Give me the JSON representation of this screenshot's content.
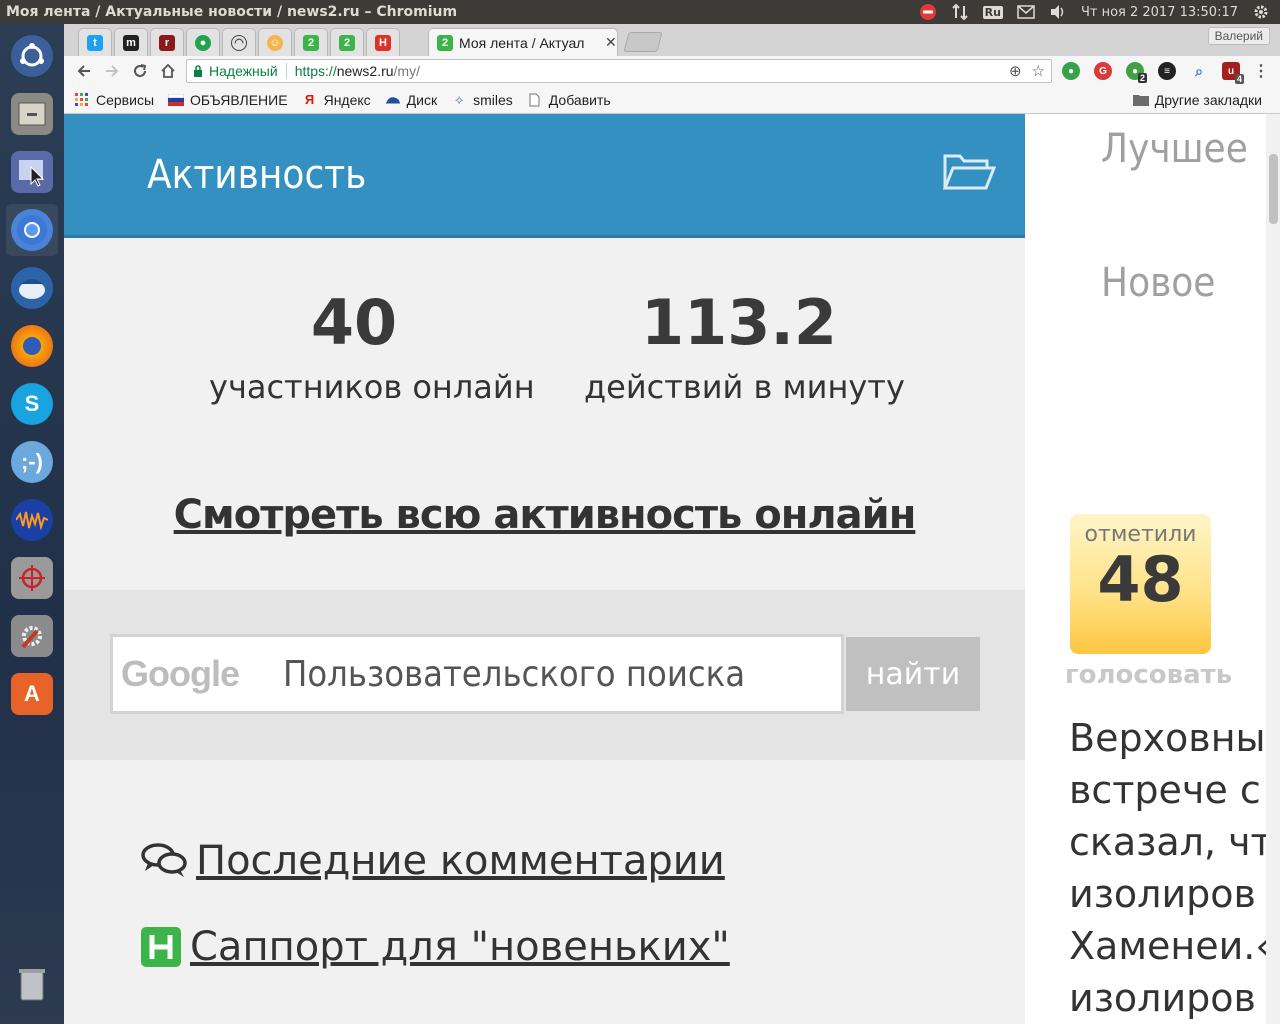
{
  "window": {
    "title": "Моя лента / Актуальные новости / news2.ru – Chromium"
  },
  "system_tray": {
    "keyboard_layout": "Ru",
    "datetime": "Чт ноя  2 2017 13:50:17"
  },
  "launcher": {
    "items": [
      "ubuntu-dash",
      "files",
      "screenshot-tool",
      "chromium",
      "thunderbird",
      "firefox",
      "skype",
      "pidgin",
      "audacity",
      "screen-ruler",
      "system-settings",
      "ubuntu-software",
      "trash"
    ]
  },
  "browser": {
    "profile_name": "Валерий",
    "active_tab_label": "Моя лента / Актуал",
    "omnibox": {
      "secure_label": "Надежный",
      "url_scheme": "https://",
      "url_host": "news2.ru",
      "url_path": "/my/"
    },
    "bookmarks": [
      {
        "label": "Сервисы",
        "icon": "apps-grid-icon"
      },
      {
        "label": "ОБЪЯВЛЕНИЕ",
        "icon": "flag-icon"
      },
      {
        "label": "Яндекс",
        "icon": "yandex-icon"
      },
      {
        "label": "Диск",
        "icon": "disk-icon"
      },
      {
        "label": "smiles",
        "icon": "smiles-icon"
      },
      {
        "label": "Добавить",
        "icon": "page-icon"
      }
    ],
    "other_bookmarks": "Другие закладки",
    "extension_badges": {
      "ext3": "2",
      "ext7": "4"
    }
  },
  "page": {
    "activity_title": "Активность",
    "stats": [
      {
        "value": "40",
        "label": "участников онлайн"
      },
      {
        "value": "113.2",
        "label": "действий в минуту"
      }
    ],
    "all_activity_link": "Смотреть всю активность онлайн",
    "search": {
      "logo_text": "Google",
      "placeholder": "Пользовательского поиска",
      "button": "найти"
    },
    "links": [
      {
        "label": " Последние комментарии",
        "icon": "comments-icon"
      },
      {
        "label": "Саппорт для \"новеньких\"",
        "icon": "h-badge-icon"
      }
    ],
    "right": {
      "tab_best": "Лучшее",
      "tab_new": "Новое",
      "vote_label": "отметили",
      "vote_count": "48",
      "vote_action": "голосовать",
      "article_lines": [
        "Верховны",
        "встрече с",
        "сказал, чт",
        "изолиров",
        "Хаменеи.«",
        "изолиров"
      ]
    }
  },
  "colors": {
    "activity_header": "#3390c0",
    "secure_green": "#0b8043",
    "vote_gold": "#fcc640"
  }
}
